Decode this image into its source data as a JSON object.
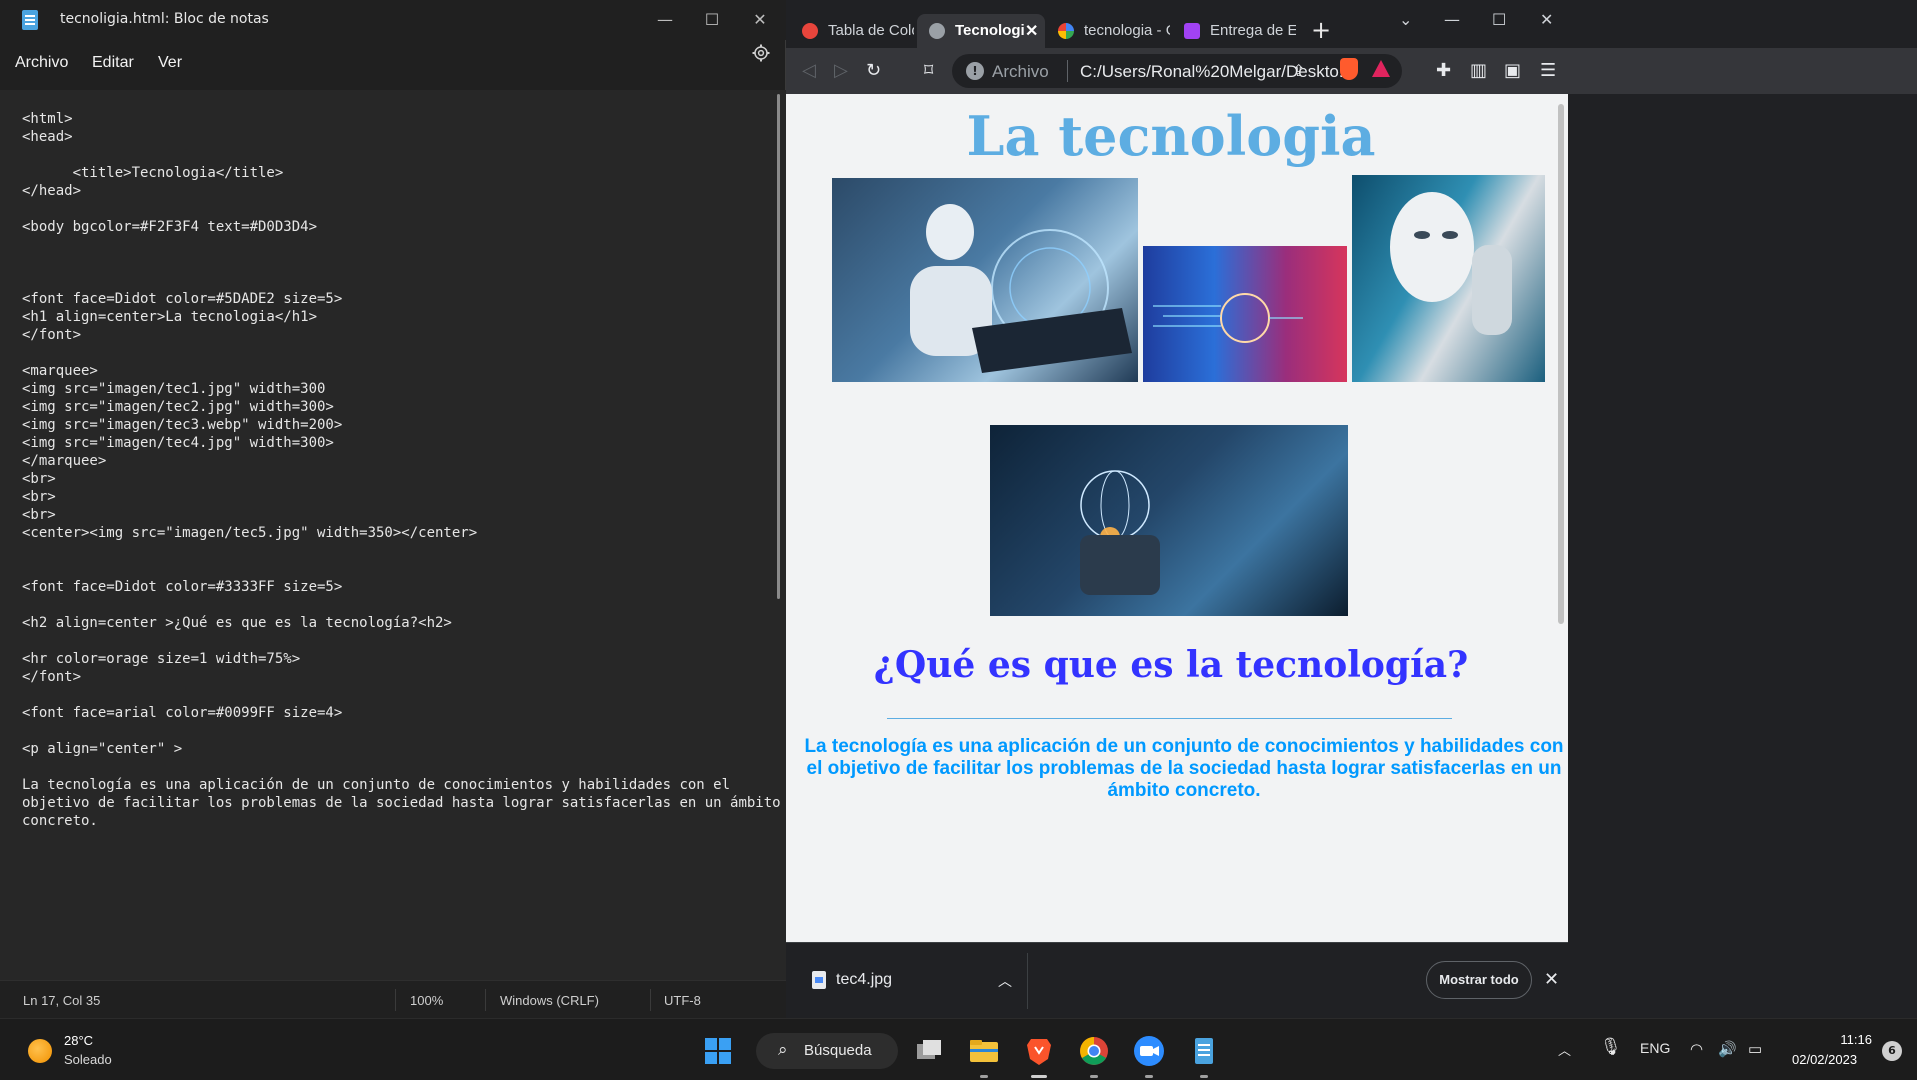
{
  "notepad": {
    "title": "tecnoligia.html: Bloc de notas",
    "menu": [
      "Archivo",
      "Editar",
      "Ver"
    ],
    "code_lines": [
      "<html>",
      "<head>",
      "",
      "      <title>Tecnologia</title>",
      "</head>",
      "",
      "<body bgcolor=#F2F3F4 text=#D0D3D4>",
      "",
      "",
      "",
      "<font face=Didot color=#5DADE2 size=5>",
      "<h1 align=center>La tecnologia</h1>",
      "</font>",
      "",
      "<marquee>",
      "<img src=\"imagen/tec1.jpg\" width=300",
      "<img src=\"imagen/tec2.jpg\" width=300>",
      "<img src=\"imagen/tec3.webp\" width=200>",
      "<img src=\"imagen/tec4.jpg\" width=300>",
      "</marquee>",
      "<br>",
      "<br>",
      "<br>",
      "<center><img src=\"imagen/tec5.jpg\" width=350></center>",
      "",
      "",
      "<font face=Didot color=#3333FF size=5>",
      "",
      "<h2 align=center >¿Qué es que es la tecnología?<h2>",
      "",
      "<hr color=orage size=1 width=75%>",
      "</font>",
      "",
      "<font face=arial color=#0099FF size=4>",
      "",
      "<p align=\"center\" >",
      "",
      "La tecnología es una aplicación de un conjunto de conocimientos y habilidades con el",
      "objetivo de facilitar los problemas de la sociedad hasta lograr satisfacerlas en un ámbito",
      "concreto."
    ],
    "status": {
      "position": "Ln 17, Col 35",
      "zoom": "100%",
      "line_ending": "Windows (CRLF)",
      "encoding": "UTF-8"
    }
  },
  "browser": {
    "tabs": [
      {
        "label": "Tabla de Colores",
        "active": false
      },
      {
        "label": "Tecnologia",
        "active": true
      },
      {
        "label": "tecnologia - Goo",
        "active": false
      },
      {
        "label": "Entrega de Evide",
        "active": false
      }
    ],
    "omnibox": {
      "scheme": "Archivo",
      "url": "C:/Users/Ronal%20Melgar/Deskto..."
    },
    "page": {
      "heading": "La tecnologia",
      "subheading": "¿Qué es que es la tecnología?",
      "paragraph": "La tecnología es una aplicación de un conjunto de conocimientos y habilidades con el objetivo de facilitar los problemas de la sociedad hasta lograr satisfacerlas en un ámbito concreto.",
      "heading_color": "#5DADE2",
      "subheading_color": "#3333FF",
      "paragraph_color": "#0099FF",
      "background": "#F2F3F4"
    },
    "download": {
      "filename": "tec4.jpg",
      "show_all": "Mostrar todo"
    }
  },
  "taskbar": {
    "weather_temp": "28°C",
    "weather_cond": "Soleado",
    "search_label": "Búsqueda",
    "language": "ENG",
    "time": "11:16",
    "date": "02/02/2023",
    "notifications": "6"
  }
}
